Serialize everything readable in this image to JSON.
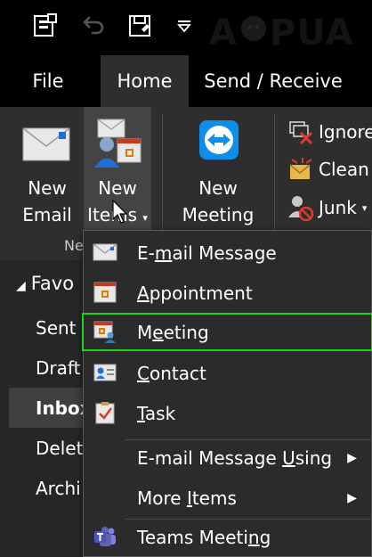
{
  "tabs": [
    {
      "label": "File"
    },
    {
      "label": "Home"
    },
    {
      "label": "Send / Receive"
    }
  ],
  "ribbon": {
    "new_email": {
      "line1": "New",
      "line2": "Email"
    },
    "new_items": {
      "line1": "New",
      "line2": "Items"
    },
    "new_meeting": {
      "line1": "New",
      "line2": "Meeting"
    },
    "group_label": "Ne",
    "ignore": "Ignore",
    "clean": "Clean",
    "junk": "Junk"
  },
  "sidebar": {
    "favorites": "Favo",
    "items": [
      "Sent",
      "Draft",
      "Inbox",
      "Delet",
      "Archi"
    ]
  },
  "menu": {
    "items": [
      {
        "pre": "E-",
        "key": "m",
        "post": "ail Message",
        "icon": "email-icon"
      },
      {
        "pre": "",
        "key": "A",
        "post": "ppointment",
        "icon": "calendar-icon"
      },
      {
        "pre": "M",
        "key": "e",
        "post": "eting",
        "icon": "meeting-icon"
      },
      {
        "pre": "",
        "key": "C",
        "post": "ontact",
        "icon": "contact-icon"
      },
      {
        "pre": "",
        "key": "T",
        "post": "ask",
        "icon": "task-icon"
      },
      {
        "pre": "E-mail Message ",
        "key": "U",
        "post": "sing",
        "icon": ""
      },
      {
        "pre": "More ",
        "key": "I",
        "post": "tems",
        "icon": ""
      },
      {
        "pre": "Teams Meeti",
        "key": "n",
        "post": "g",
        "icon": "teams-icon"
      }
    ]
  },
  "colors": {
    "highlight": "#1bd71b",
    "teams_purple": "#6264a7",
    "accent_blue": "#1e6fd9"
  }
}
